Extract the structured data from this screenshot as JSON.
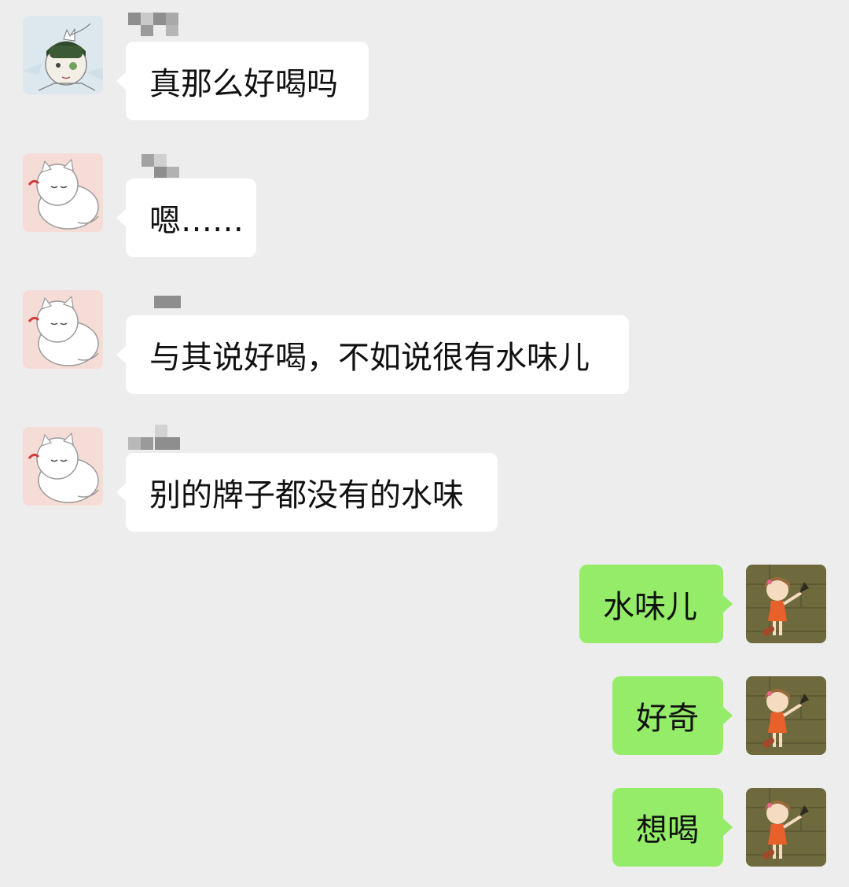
{
  "chat": {
    "messages": [
      {
        "direction": "incoming",
        "sender_avatar": "girl-with-cat-avatar",
        "text": "真那么好喝吗"
      },
      {
        "direction": "incoming",
        "sender_avatar": "white-cat-avatar",
        "text": "嗯……"
      },
      {
        "direction": "incoming",
        "sender_avatar": "white-cat-avatar",
        "text": "与其说好喝，不如说很有水味儿"
      },
      {
        "direction": "incoming",
        "sender_avatar": "white-cat-avatar",
        "text": "别的牌子都没有的水味"
      },
      {
        "direction": "outgoing",
        "sender_avatar": "girl-orange-dress-avatar",
        "text": "水味儿"
      },
      {
        "direction": "outgoing",
        "sender_avatar": "girl-orange-dress-avatar",
        "text": "好奇"
      },
      {
        "direction": "outgoing",
        "sender_avatar": "girl-orange-dress-avatar",
        "text": "想喝"
      }
    ]
  },
  "colors": {
    "background": "#ededed",
    "incoming_bubble": "#ffffff",
    "outgoing_bubble": "#95ec69",
    "text": "#111111"
  }
}
